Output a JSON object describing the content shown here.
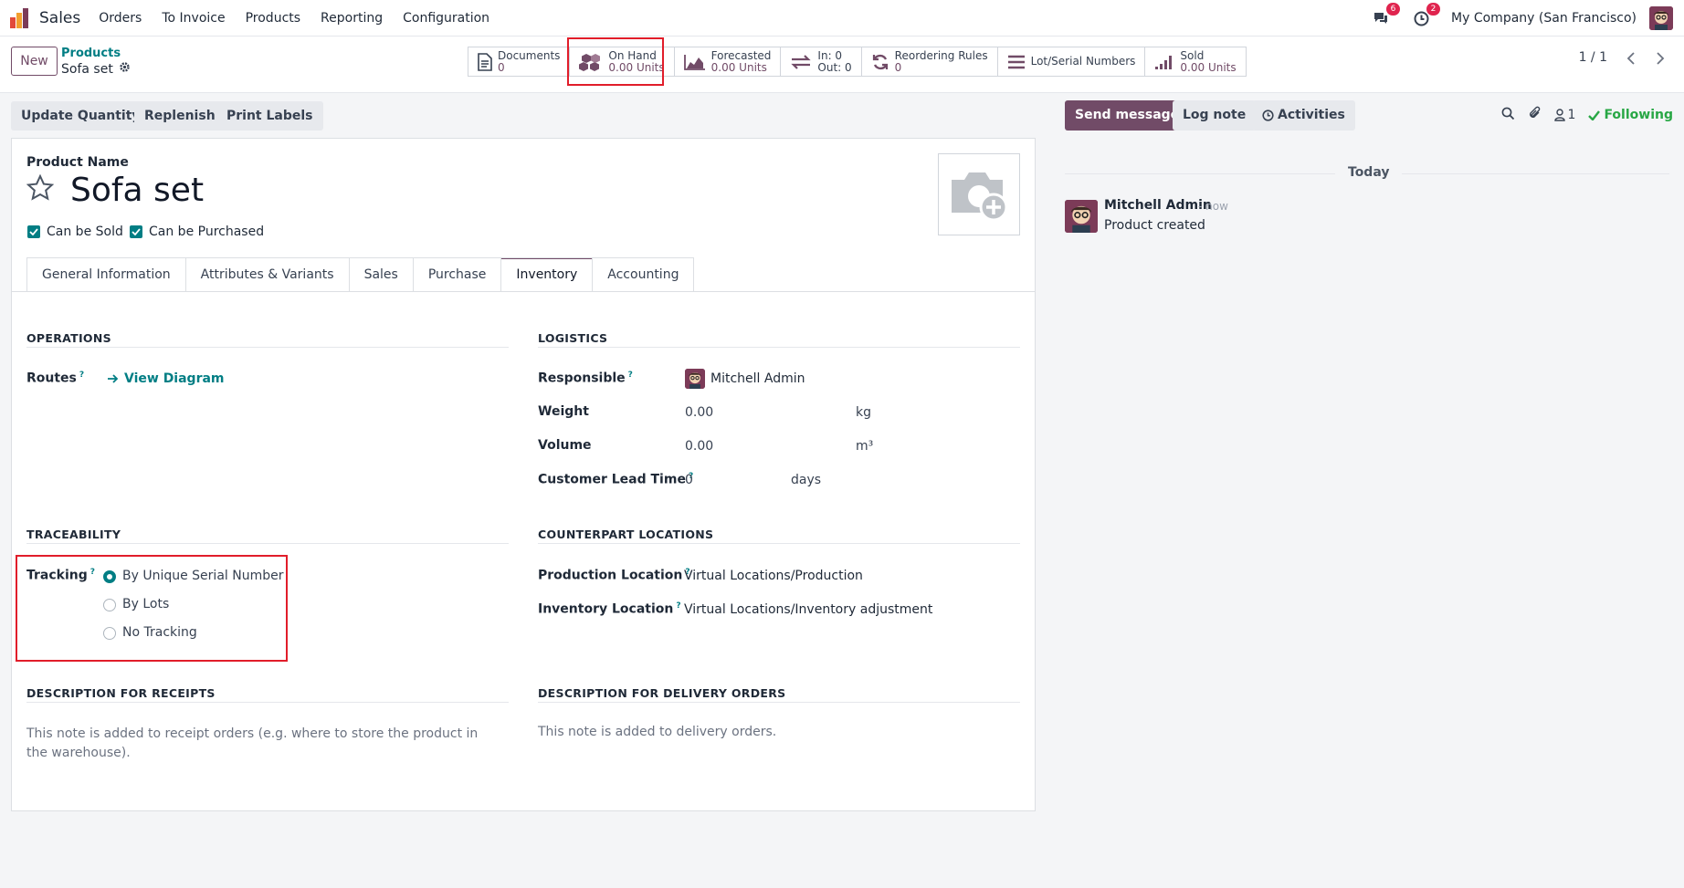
{
  "topnav": {
    "app_name": "Sales",
    "menu": [
      "Orders",
      "To Invoice",
      "Products",
      "Reporting",
      "Configuration"
    ],
    "messages_badge": "6",
    "activities_badge": "2",
    "company": "My Company (San Francisco)",
    "icons": [
      "app-logo-icon",
      "chat-icon",
      "clock-icon",
      "avatar"
    ]
  },
  "control": {
    "new_label": "New",
    "breadcrumb_parent": "Products",
    "breadcrumb_current": "Sofa set",
    "pager": "1 / 1",
    "stat_buttons": [
      {
        "label": "Documents",
        "value": "0",
        "icon": "file-icon"
      },
      {
        "label": "On Hand",
        "value": "0.00 Units",
        "icon": "cubes-icon"
      },
      {
        "label": "Forecasted",
        "value": "0.00 Units",
        "icon": "area-chart-icon"
      },
      {
        "label": "In: 0",
        "value": "Out: 0",
        "icon": "exchange-icon"
      },
      {
        "label": "Reordering Rules",
        "value": "0",
        "icon": "refresh-icon"
      },
      {
        "label": "Lot/Serial Numbers",
        "value": "",
        "icon": "bars-icon"
      },
      {
        "label": "Sold",
        "value": "0.00 Units",
        "icon": "signal-icon"
      }
    ]
  },
  "actions": [
    "Update Quantity",
    "Replenish",
    "Print Labels"
  ],
  "chatter": {
    "send_message": "Send message",
    "log_note": "Log note",
    "activities": "Activities",
    "followers_count": "1",
    "following": "Following",
    "today": "Today",
    "message": {
      "author": "Mitchell Admin",
      "time": "- now",
      "body": "Product created"
    }
  },
  "form": {
    "product_name_label": "Product Name",
    "product_name": "Sofa set",
    "can_be_sold": "Can be Sold",
    "can_be_purchased": "Can be Purchased",
    "tabs": [
      "General Information",
      "Attributes & Variants",
      "Sales",
      "Purchase",
      "Inventory",
      "Accounting"
    ],
    "active_tab": "Inventory",
    "operations": {
      "title": "OPERATIONS",
      "routes_label": "Routes",
      "view_diagram": "View Diagram"
    },
    "logistics": {
      "title": "LOGISTICS",
      "responsible_label": "Responsible",
      "responsible_value": "Mitchell Admin",
      "weight_label": "Weight",
      "weight_value": "0.00",
      "weight_unit": "kg",
      "volume_label": "Volume",
      "volume_value": "0.00",
      "volume_unit": "m³",
      "lead_time_label": "Customer Lead Time",
      "lead_time_value": "0",
      "lead_time_unit": "days"
    },
    "traceability": {
      "title": "TRACEABILITY",
      "tracking_label": "Tracking",
      "options": [
        "By Unique Serial Number",
        "By Lots",
        "No Tracking"
      ],
      "selected": "By Unique Serial Number"
    },
    "counterpart": {
      "title": "COUNTERPART LOCATIONS",
      "production_label": "Production Location",
      "production_value": "Virtual Locations/Production",
      "inventory_label": "Inventory Location",
      "inventory_value": "Virtual Locations/Inventory adjustment"
    },
    "desc_receipts": {
      "title": "DESCRIPTION FOR RECEIPTS",
      "placeholder": "This note is added to receipt orders (e.g. where to store the product in the warehouse)."
    },
    "desc_delivery": {
      "title": "DESCRIPTION FOR DELIVERY ORDERS",
      "placeholder": "This note is added to delivery orders."
    }
  },
  "colors": {
    "brand": "#714b67",
    "accent": "#017e84",
    "highlight": "#e11d2a",
    "following": "#28a745"
  }
}
